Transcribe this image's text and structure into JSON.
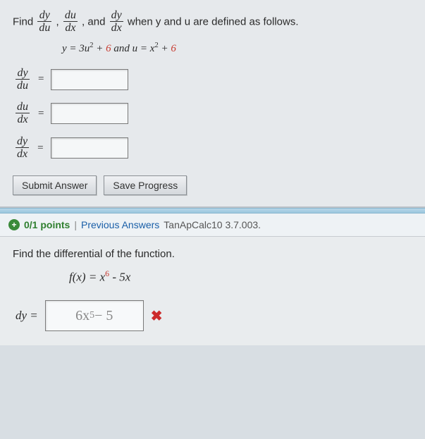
{
  "q1": {
    "prompt_prefix": "Find ",
    "frac1_num": "dy",
    "frac1_den": "du",
    "sep1": ", ",
    "frac2_num": "du",
    "frac2_den": "dx",
    "sep2": ", and ",
    "frac3_num": "dy",
    "frac3_den": "dx",
    "prompt_suffix": " when y and u are defined as follows.",
    "defs_y_lead": "y = 3u",
    "defs_y_exp": "2",
    "defs_y_plus": " + ",
    "defs_y_const": "6",
    "defs_and": "   and   ",
    "defs_u_lead": "u = x",
    "defs_u_exp": "2",
    "defs_u_plus": " + ",
    "defs_u_const": "6",
    "row1_num": "dy",
    "row1_den": "du",
    "row2_num": "du",
    "row2_den": "dx",
    "row3_num": "dy",
    "row3_den": "dx",
    "eq": "=",
    "btn_submit": "Submit Answer",
    "btn_save": "Save Progress"
  },
  "scorebar": {
    "plus": "+",
    "points": "0/1 points",
    "sep": "|",
    "prev": "Previous Answers",
    "ref": "TanApCalc10 3.7.003."
  },
  "q2": {
    "prompt": "Find the differential of the function.",
    "f_lead": "f(x) = x",
    "f_exp": "6",
    "f_tail": " - 5x",
    "lhs": "dy =",
    "ans_lead": "6x",
    "ans_exp": "5",
    "ans_tail": " − 5",
    "wrong": "✖"
  }
}
